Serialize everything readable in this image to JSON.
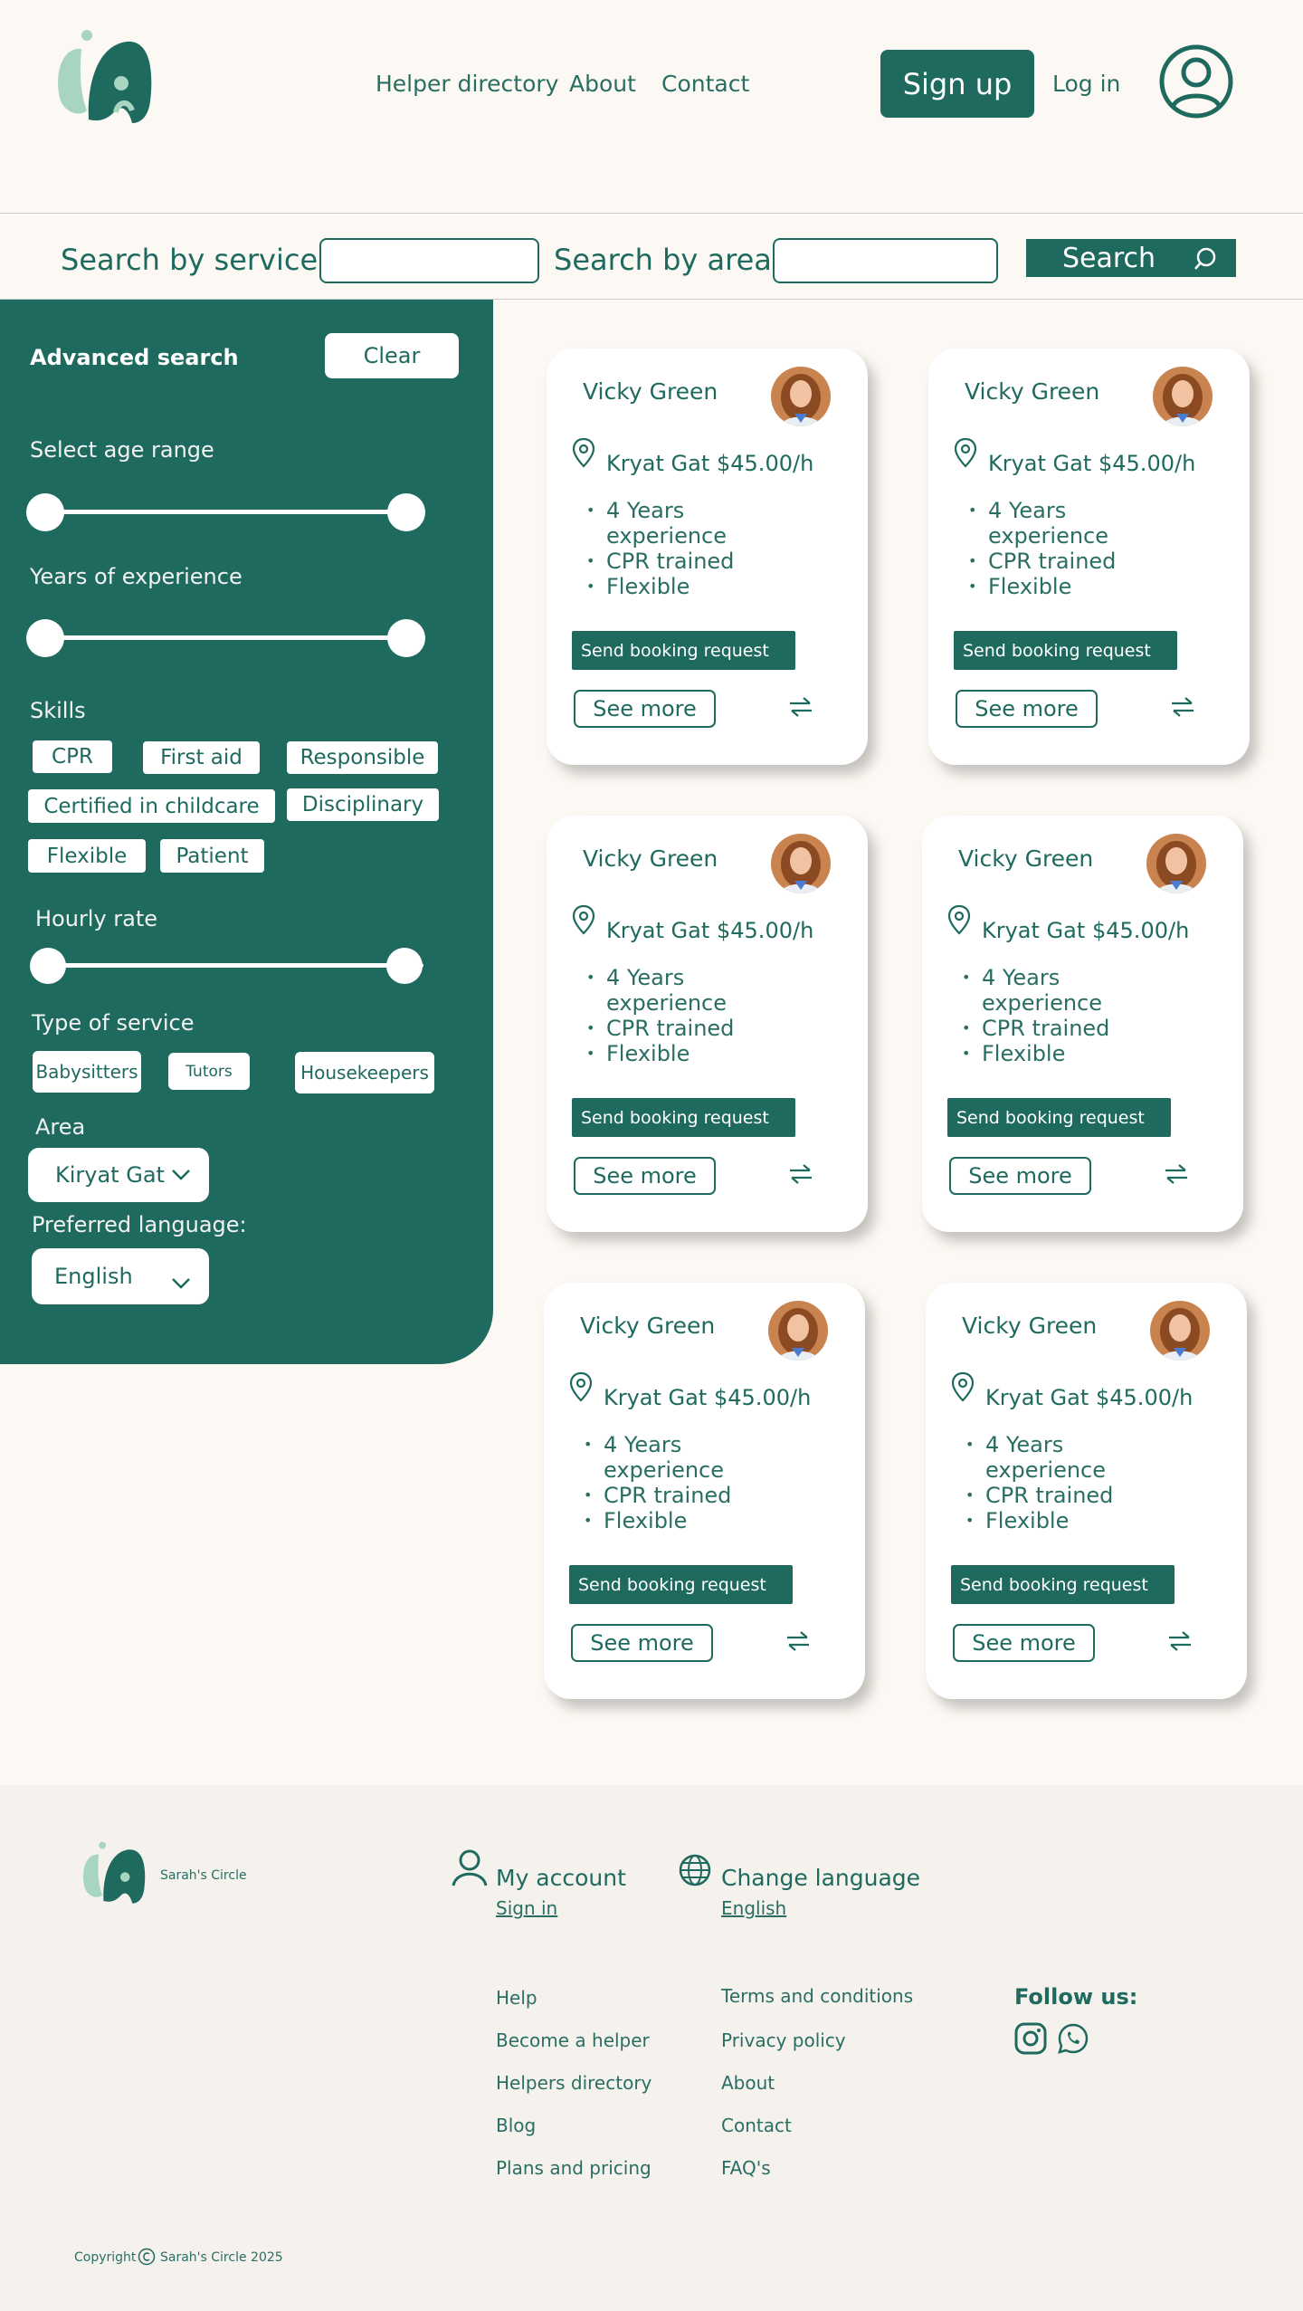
{
  "header": {
    "logo_icon": "sarahs-circle-logo-icon",
    "nav": [
      "Helper directory",
      "About",
      "Contact"
    ],
    "signup_label": "Sign up",
    "login_label": "Log in",
    "profile_icon": "user-circle-icon"
  },
  "search": {
    "service_label": "Search by service:",
    "area_label": "Search by area:",
    "service_value": "",
    "area_value": "",
    "button_label": "Search",
    "button_icon": "search-icon"
  },
  "sidebar": {
    "title": "Advanced search",
    "clear_label": "Clear",
    "age_label": "Select age range",
    "experience_label": "Years of experience",
    "skills_label": "Skills",
    "skills": [
      "CPR",
      "First aid",
      "Responsible",
      "Certified in childcare",
      "Disciplinary",
      "Flexible",
      "Patient"
    ],
    "rate_label": "Hourly rate",
    "service_type_label": "Type of service",
    "service_types": [
      "Babysitters",
      "Tutors",
      "Housekeepers"
    ],
    "area_label": "Area",
    "area_value": "Kiryat Gat",
    "language_label": "Preferred language:",
    "language_value": "English"
  },
  "cards": [
    {
      "name": "Vicky Green",
      "location": "Kryat Gat",
      "rate": "$45.00/h",
      "bullets": [
        "4 Years experience",
        "CPR trained",
        "Flexible"
      ],
      "book_label": "Send booking request",
      "more_label": "See more"
    },
    {
      "name": "Vicky Green",
      "location": "Kryat Gat",
      "rate": "$45.00/h",
      "bullets": [
        "4 Years experience",
        "CPR trained",
        "Flexible"
      ],
      "book_label": "Send booking request",
      "more_label": "See more"
    },
    {
      "name": "Vicky Green",
      "location": "Kryat Gat",
      "rate": "$45.00/h",
      "bullets": [
        "4 Years experience",
        "CPR trained",
        "Flexible"
      ],
      "book_label": "Send booking request",
      "more_label": "See more"
    },
    {
      "name": "Vicky Green",
      "location": "Kryat Gat",
      "rate": "$45.00/h",
      "bullets": [
        "4 Years experience",
        "CPR trained",
        "Flexible"
      ],
      "book_label": "Send booking request",
      "more_label": "See more"
    },
    {
      "name": "Vicky Green",
      "location": "Kryat Gat",
      "rate": "$45.00/h",
      "bullets": [
        "4 Years experience",
        "CPR trained",
        "Flexible"
      ],
      "book_label": "Send booking request",
      "more_label": "See more"
    },
    {
      "name": "Vicky Green",
      "location": "Kryat Gat",
      "rate": "$45.00/h",
      "bullets": [
        "4 Years experience",
        "CPR trained",
        "Flexible"
      ],
      "book_label": "Send booking request",
      "more_label": "See more"
    }
  ],
  "footer": {
    "brand": "Sarah's Circle",
    "account_label": "My account",
    "account_link": "Sign in",
    "language_label": "Change language",
    "language_link": "English",
    "col1": [
      "Help",
      "Become a helper",
      "Helpers directory",
      "Blog",
      "Plans and pricing"
    ],
    "col2": [
      "Terms and conditions",
      "Privacy policy",
      "About",
      "Contact",
      "FAQ's"
    ],
    "follow_label": "Follow us:",
    "social_icons": [
      "instagram-icon",
      "whatsapp-icon"
    ],
    "copyright_prefix": "Copyright",
    "copyright_text": "Sarah's Circle 2025"
  },
  "colors": {
    "primary": "#1f6a5f",
    "background": "#fcf8f3",
    "footer_bg": "#f5f2ee",
    "logo_light": "#a8d5bf"
  }
}
